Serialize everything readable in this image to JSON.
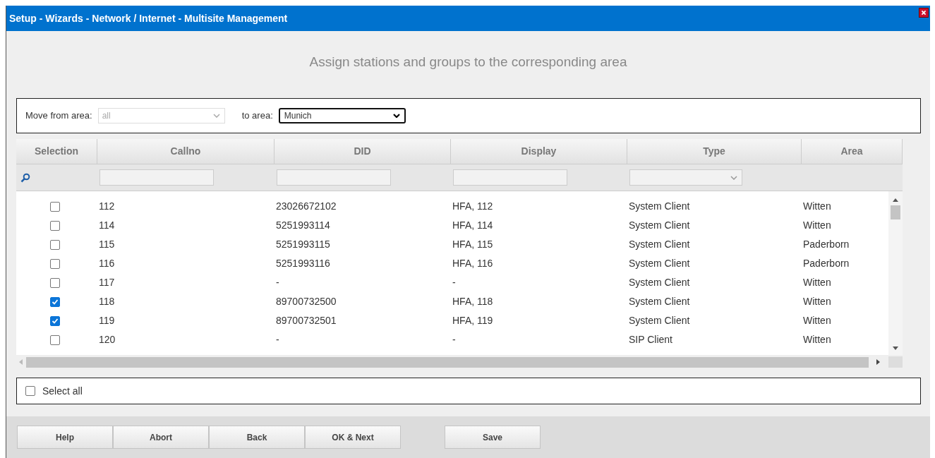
{
  "window": {
    "title": "Setup - Wizards - Network / Internet - Multisite Management"
  },
  "heading": "Assign stations and groups to the corresponding area",
  "move": {
    "from_label": "Move from area:",
    "from_value": "all",
    "from_disabled": true,
    "to_label": "to area:",
    "to_value": "Munich"
  },
  "table": {
    "columns": [
      {
        "label": "Selection",
        "kind": "search"
      },
      {
        "label": "Callno",
        "kind": "text"
      },
      {
        "label": "DID",
        "kind": "text"
      },
      {
        "label": "Display",
        "kind": "text"
      },
      {
        "label": "Type",
        "kind": "select"
      },
      {
        "label": "Area",
        "kind": "plain"
      }
    ],
    "rows": [
      {
        "checked": false,
        "cells": [
          "112",
          "23026672102",
          "HFA, 112",
          "System Client",
          "Witten"
        ]
      },
      {
        "checked": false,
        "cells": [
          "114",
          "5251993114",
          "HFA, 114",
          "System Client",
          "Witten"
        ]
      },
      {
        "checked": false,
        "cells": [
          "115",
          "5251993115",
          "HFA, 115",
          "System Client",
          "Paderborn"
        ]
      },
      {
        "checked": false,
        "cells": [
          "116",
          "5251993116",
          "HFA, 116",
          "System Client",
          "Paderborn"
        ]
      },
      {
        "checked": false,
        "cells": [
          "117",
          "-",
          "-",
          "System Client",
          "Witten"
        ]
      },
      {
        "checked": true,
        "cells": [
          "118",
          "89700732500",
          "HFA, 118",
          "System Client",
          "Witten"
        ]
      },
      {
        "checked": true,
        "cells": [
          "119",
          "89700732501",
          "HFA, 119",
          "System Client",
          "Witten"
        ]
      },
      {
        "checked": false,
        "cells": [
          "120",
          "-",
          "-",
          "SIP Client",
          "Witten"
        ]
      }
    ]
  },
  "select_all": {
    "label": "Select all",
    "checked": false
  },
  "buttons": [
    "Help",
    "Abort",
    "Back",
    "OK & Next",
    "Save"
  ]
}
